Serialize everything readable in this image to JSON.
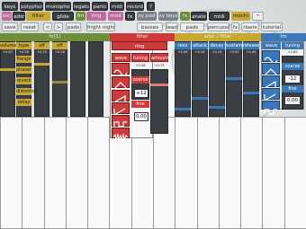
{
  "toolbar_row1": [
    {
      "label": "keys",
      "style": "dk"
    },
    {
      "label": "polyphonic",
      "style": "dk"
    },
    {
      "label": "monophonic",
      "style": "dk"
    },
    {
      "label": "legato",
      "style": "dk"
    },
    {
      "label": "panic",
      "style": "dk"
    },
    {
      "label": "midi",
      "style": "dk"
    },
    {
      "label": "record",
      "style": "dk"
    },
    {
      "label": "?",
      "style": "dk"
    }
  ],
  "toolbar_row2": [
    {
      "label": "osc",
      "style": "pink"
    },
    {
      "label": "adsr",
      "style": "dk"
    },
    {
      "label": "filter",
      "style": "gold"
    },
    {
      "label": "glide",
      "style": "dk"
    },
    {
      "label": "fm",
      "style": "grn"
    },
    {
      "label": "ring",
      "style": "pink"
    },
    {
      "label": "mod",
      "style": "pink"
    },
    {
      "label": "fx",
      "style": "dk"
    },
    {
      "label": "xy pad",
      "style": "slate"
    },
    {
      "label": "xy keys",
      "style": "slate"
    },
    {
      "label": "fx",
      "style": "grn"
    },
    {
      "label": "analog",
      "style": "dk"
    },
    {
      "label": "midi",
      "style": "dk"
    },
    {
      "label": "mochi",
      "style": "gold"
    },
    {
      "label": "^",
      "style": "lt"
    }
  ],
  "toolbar_row3": {
    "save": "save",
    "reset": "reset",
    "left": "<",
    "right": ">",
    "pads": "pads",
    "preset": "fright night",
    "banks": [
      "basses",
      "leads",
      "pads",
      "percussive",
      "fx",
      "risers",
      "tutorial"
    ]
  },
  "headers": {
    "fx": "fx(1)",
    "filter": "filter",
    "adsr": "adsr / filter",
    "fm": "fm"
  },
  "fx_panel": {
    "columns": [
      {
        "label": "volume",
        "value": "+0.67"
      },
      {
        "label": "type",
        "value": "+0.56"
      },
      {
        "label": "off",
        "value": "+0.25"
      },
      {
        "label": "off",
        "value": "+0.00"
      }
    ],
    "buttons": [
      "flange",
      "phaser",
      "reverb",
      "distortion",
      "delay"
    ]
  },
  "ring_panel": {
    "title": "ring",
    "columns": [
      "wave",
      "tuning",
      "amount"
    ],
    "values": [
      "+0.08",
      "+0.73"
    ],
    "coarse_label": "coarse",
    "coarse_value": "+12",
    "fine_label": "fine",
    "fine_value": "0.00"
  },
  "adsr_panel": {
    "columns": [
      {
        "label": "reso",
        "value": "+0.08"
      },
      {
        "label": "attack",
        "value": "+0.18"
      },
      {
        "label": "decay",
        "value": "+0.15"
      },
      {
        "label": "sustain",
        "value": "+0.55"
      },
      {
        "label": "release",
        "value": "+0.45"
      }
    ]
  },
  "fm_panel": {
    "columns": [
      "wave",
      "tuning"
    ],
    "value": "+0.85",
    "coarse_label": "coarse",
    "coarse_value": "-12",
    "fine_label": "fine",
    "fine_value": "0.00"
  },
  "colors": {
    "filter": "#c8a832",
    "ring": "#cd3a3a",
    "fm": "#3a78b8",
    "fx": "#6e8e3a"
  }
}
